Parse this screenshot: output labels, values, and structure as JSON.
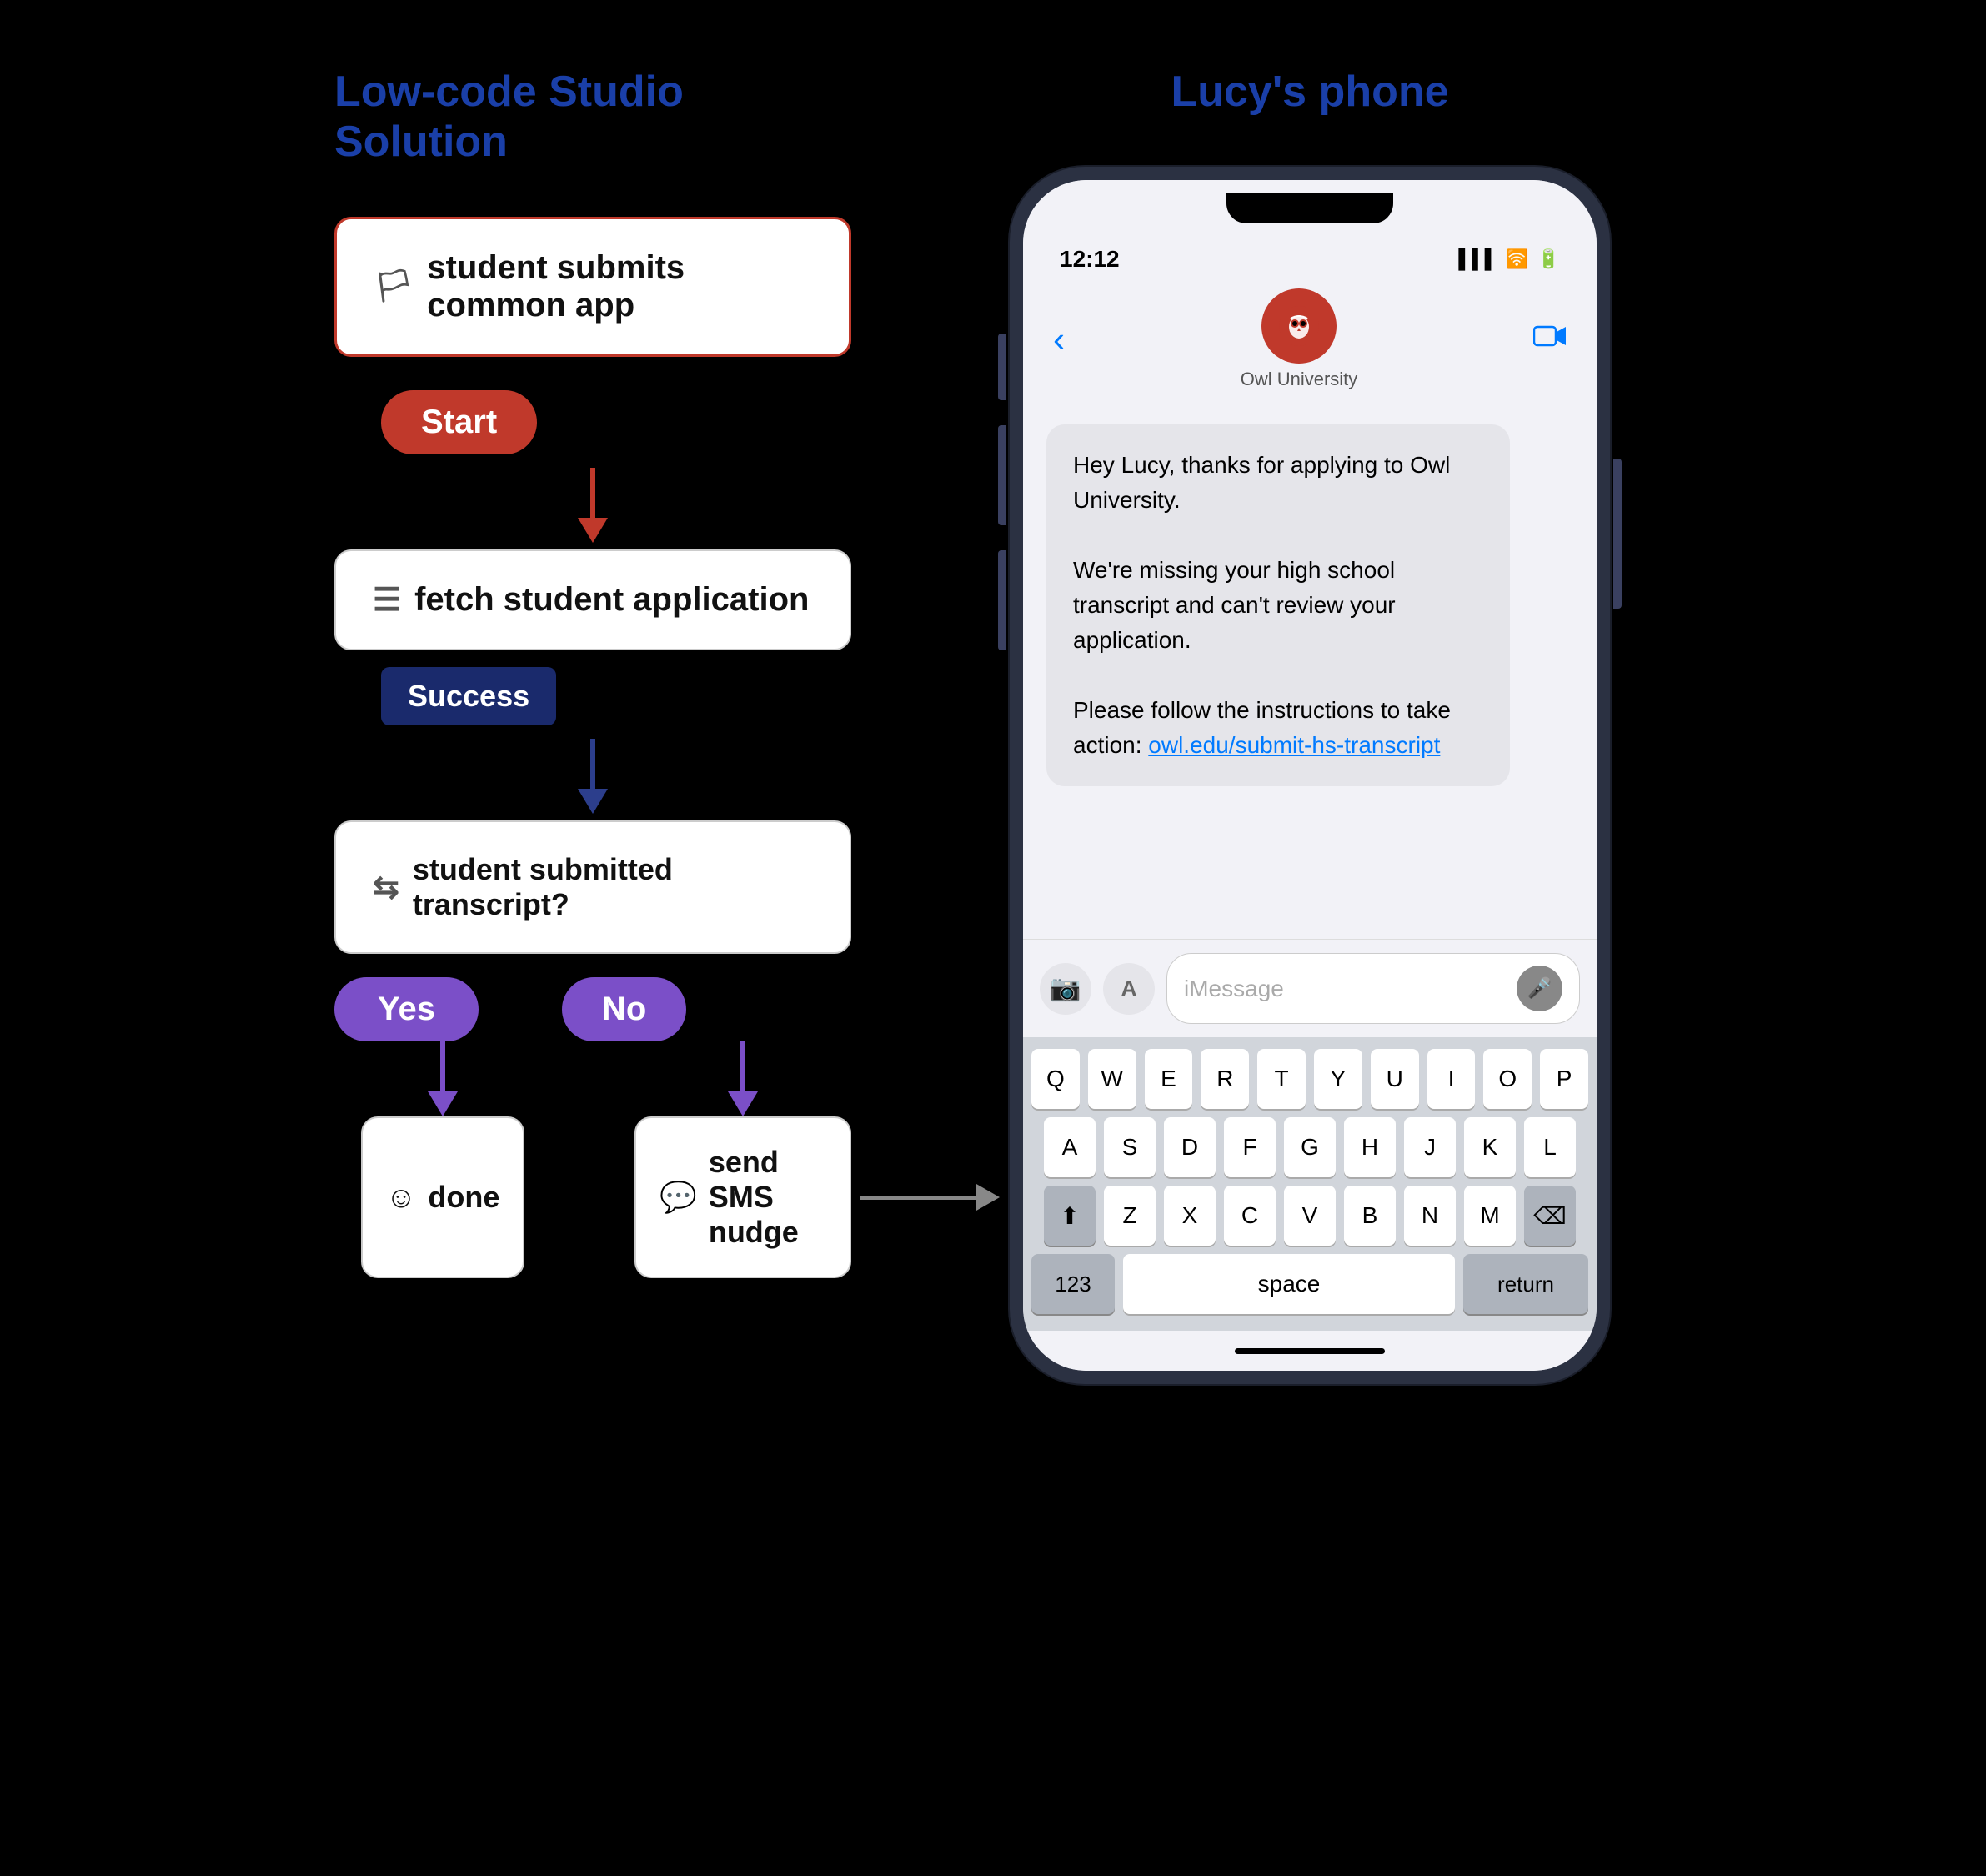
{
  "left_title": "Low-code Studio Solution",
  "right_title": "Lucy's phone",
  "flow": {
    "step1_label": "student submits common app",
    "step1_icon": "🏳",
    "start_btn": "Start",
    "step2_label": "fetch student application",
    "step2_icon": "📄",
    "success_badge": "Success",
    "step3_label": "student submitted transcript?",
    "step3_icon": "⇄",
    "yes_btn": "Yes",
    "no_btn": "No",
    "done_label": "done",
    "done_icon": "☺",
    "sms_label": "send SMS nudge",
    "sms_icon": "💬"
  },
  "phone": {
    "time": "12:12",
    "contact_name": "Owl University",
    "message_text": "Hey Lucy, thanks for applying to Owl University.\n\nWe're missing your high school transcript and can't review your application.\n\nPlease follow the instructions to take action: owl.edu/submit-hs-transcript",
    "link": "owl.edu/submit-hs-transcript",
    "input_placeholder": "iMessage",
    "keyboard": {
      "row1": [
        "Q",
        "W",
        "E",
        "R",
        "T",
        "Y",
        "U",
        "I",
        "O",
        "P"
      ],
      "row2": [
        "A",
        "S",
        "D",
        "F",
        "G",
        "H",
        "J",
        "K",
        "L"
      ],
      "row3": [
        "Z",
        "X",
        "C",
        "V",
        "B",
        "N",
        "M"
      ],
      "bottom": [
        "123",
        "space",
        "return"
      ]
    }
  },
  "colors": {
    "red": "#c0392b",
    "blue": "#2c3e8c",
    "purple": "#7b4fc8",
    "imessage_blue": "#007aff",
    "dark_navy": "#1a2a6c"
  }
}
